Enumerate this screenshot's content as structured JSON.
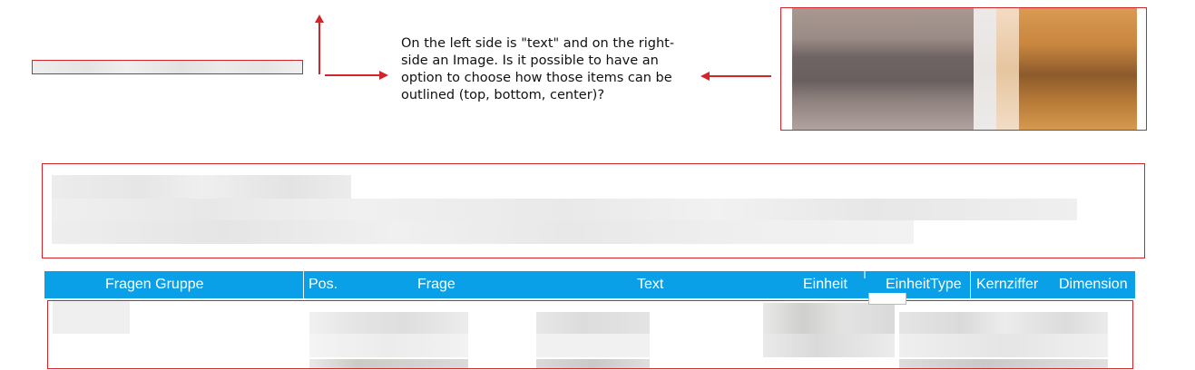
{
  "annotation": {
    "text": "On the left side is \"text\" and on the right-side an Image. Is it possible to have an option to choose how those items can be outlined (top, bottom, center)?"
  },
  "table_header": {
    "columns": [
      "Fragen Gruppe",
      "Pos.",
      "Frage",
      "Text",
      "Einheit",
      "EinheitType",
      "Kernziffer",
      "Dimension"
    ]
  },
  "colors": {
    "accent": "#0aa0e8",
    "annotation_red": "#d0262b"
  }
}
